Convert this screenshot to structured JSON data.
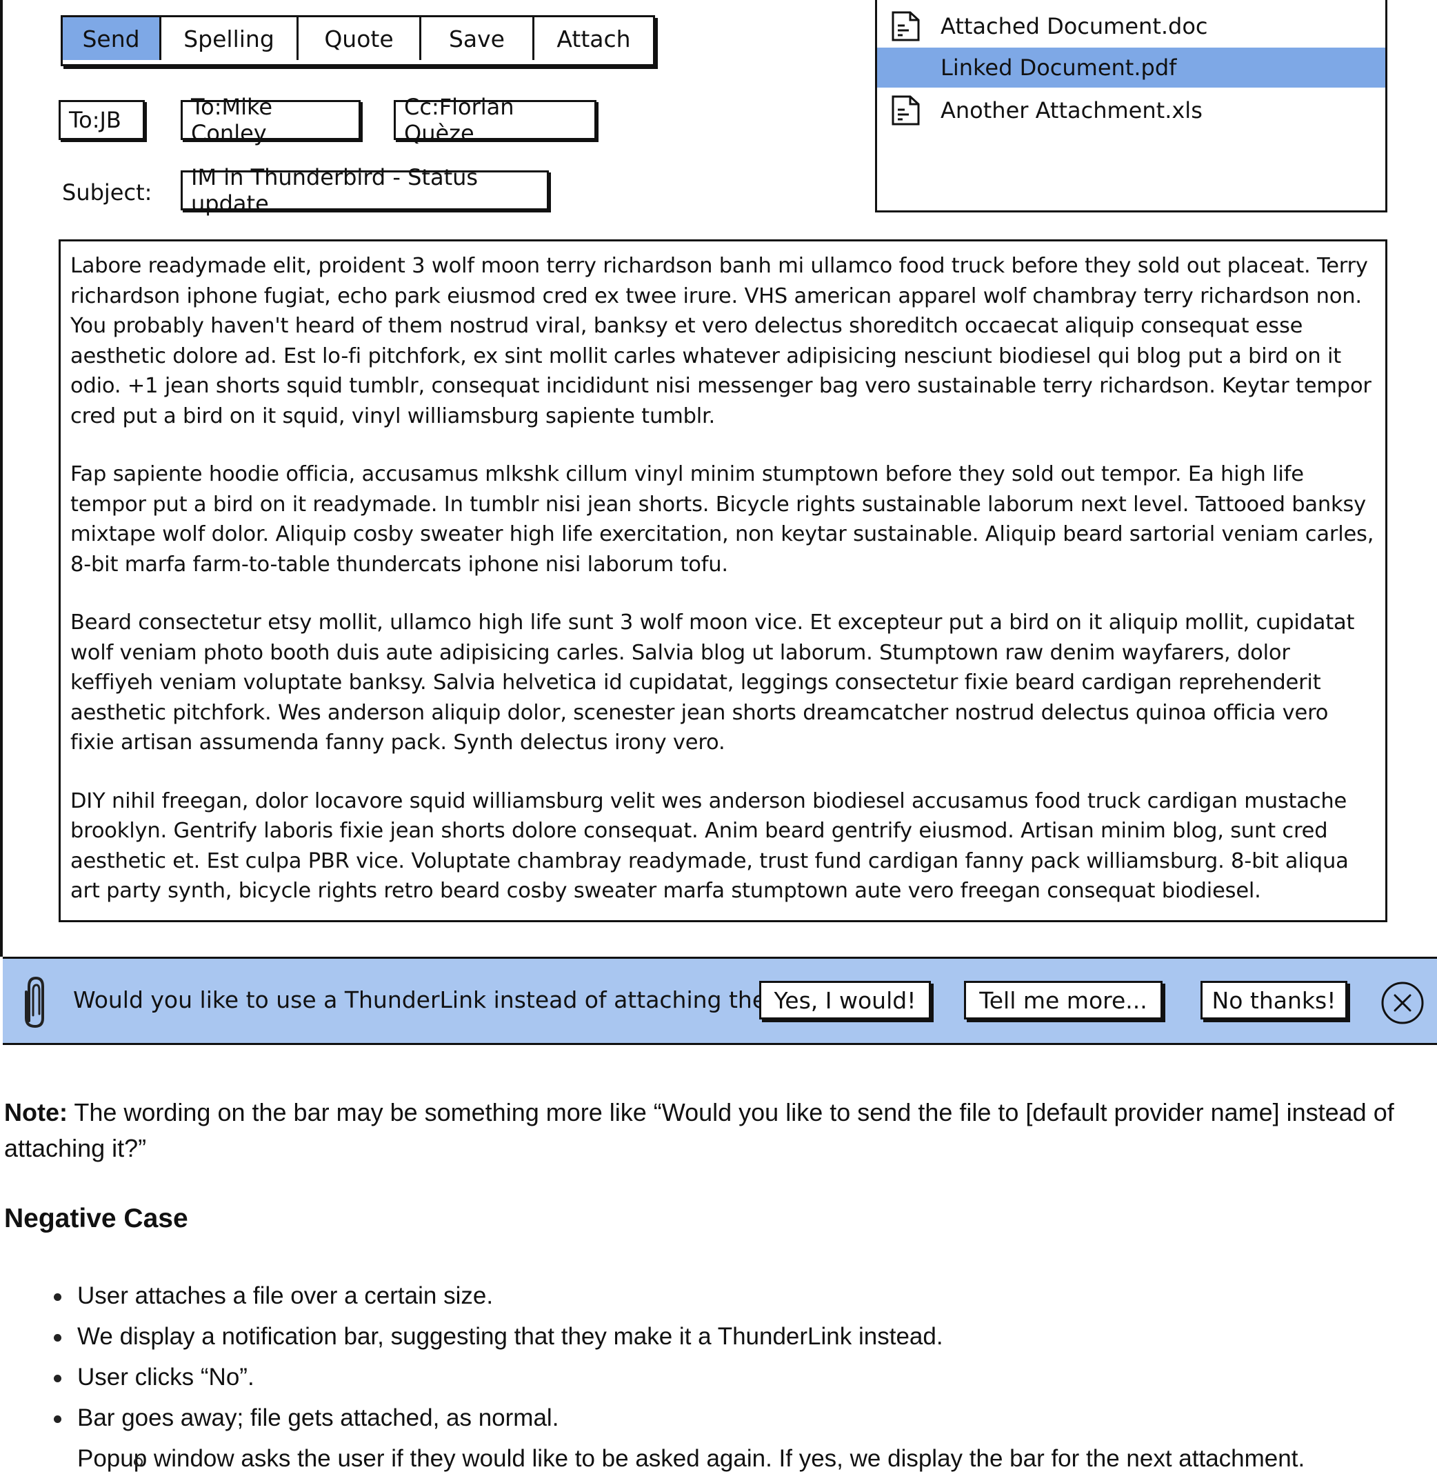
{
  "toolbar": {
    "buttons": [
      {
        "label": "Send",
        "active": true
      },
      {
        "label": "Spelling",
        "active": false
      },
      {
        "label": "Quote",
        "active": false
      },
      {
        "label": "Save",
        "active": false
      },
      {
        "label": "Attach",
        "active": false
      }
    ]
  },
  "recipients": [
    {
      "label": "To:JB"
    },
    {
      "label": "To:Mike Conley"
    },
    {
      "label": "Cc:Florian Quèze"
    }
  ],
  "subject": {
    "label": "Subject:",
    "value": "IM in Thunderbird - Status update"
  },
  "attachments": [
    {
      "name": "Attached Document.doc",
      "icon": "document-icon",
      "selected": false
    },
    {
      "name": "Linked Document.pdf",
      "icon": "",
      "selected": true
    },
    {
      "name": "Another Attachment.xls",
      "icon": "document-icon",
      "selected": false
    }
  ],
  "message_body": {
    "paragraphs": [
      "Labore readymade elit, proident 3 wolf moon terry richardson banh mi ullamco food truck before they sold out placeat. Terry richardson iphone fugiat, echo park eiusmod cred ex twee irure. VHS american apparel wolf chambray terry richardson non. You probably haven't heard of them nostrud viral, banksy et vero delectus shoreditch occaecat aliquip consequat esse aesthetic dolore ad. Est lo-fi pitchfork, ex sint mollit carles whatever adipisicing nesciunt biodiesel qui blog put a bird on it odio. +1 jean shorts squid tumblr, consequat incididunt nisi messenger bag vero sustainable terry richardson. Keytar tempor cred put a bird on it squid, vinyl williamsburg sapiente tumblr.",
      "Fap sapiente hoodie officia, accusamus mlkshk cillum vinyl minim stumptown before they sold out tempor. Ea high life tempor put a bird on it readymade. In tumblr nisi jean shorts. Bicycle rights sustainable laborum next level. Tattooed banksy mixtape wolf dolor. Aliquip cosby sweater high life exercitation, non keytar sustainable. Aliquip beard sartorial veniam carles, 8-bit marfa farm-to-table thundercats iphone nisi laborum tofu.",
      "Beard consectetur etsy mollit, ullamco high life sunt 3 wolf moon vice. Et excepteur put a bird on it aliquip mollit, cupidatat wolf veniam photo booth duis aute adipisicing carles. Salvia blog ut laborum. Stumptown raw denim wayfarers, dolor keffiyeh veniam voluptate banksy. Salvia helvetica id cupidatat, leggings consectetur fixie beard cardigan reprehenderit aesthetic pitchfork. Wes anderson aliquip dolor, scenester jean shorts dreamcatcher nostrud delectus quinoa officia vero fixie artisan assumenda fanny pack. Synth delectus irony vero.",
      "DIY nihil freegan, dolor locavore squid williamsburg velit wes anderson biodiesel accusamus food truck cardigan mustache brooklyn. Gentrify laboris fixie jean shorts dolore consequat. Anim beard gentrify eiusmod. Artisan minim blog, sunt cred aesthetic et. Est culpa PBR vice. Voluptate chambray readymade, trust fund cardigan fanny pack williamsburg. 8-bit aliqua art party synth, bicycle rights retro beard cosby sweater marfa stumptown aute vero freegan consequat biodiesel."
    ]
  },
  "notification_bar": {
    "icon": "paperclip-icon",
    "message": "Would you like to use a ThunderLink instead of attaching the file?",
    "buttons": [
      "Yes, I would!",
      "Tell me more...",
      "No thanks!"
    ],
    "close_icon": "close-icon",
    "background": "#a9c6f0"
  },
  "colors": {
    "accent": "#7ea8e6",
    "notification": "#a9c6f0"
  },
  "document": {
    "note_label": "Note:",
    "note_text": " The wording on the bar may be something more like “Would you like to send the file to [default provider name] instead of attaching it?”",
    "negative_case_heading": "Negative Case",
    "steps": [
      "User attaches a file over a certain size.",
      "We display a notification bar, suggesting that they make it a ThunderLink instead.",
      "User clicks “No”.",
      "Bar goes away; file gets attached, as normal."
    ],
    "sub_step": "Popup window asks the user if they would like to be asked again. If yes, we display the bar for the next attachment."
  }
}
